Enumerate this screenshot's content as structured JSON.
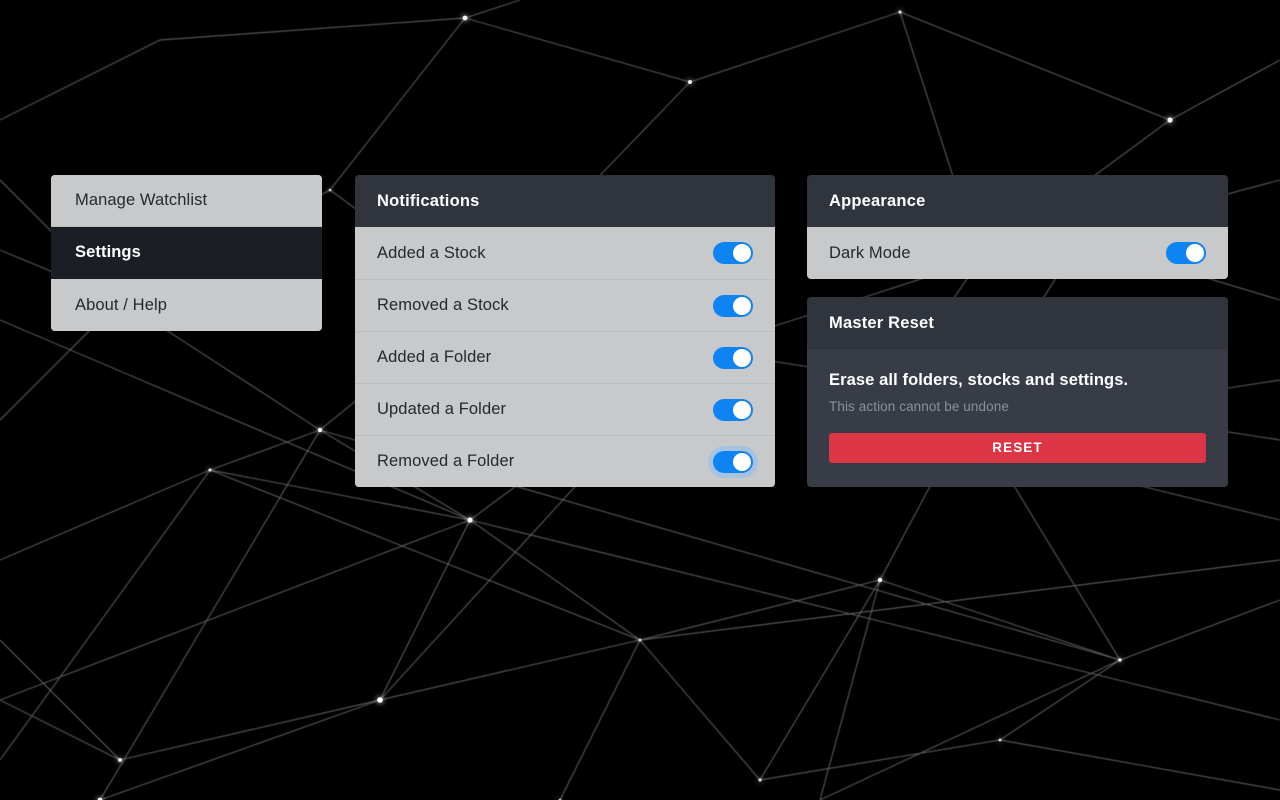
{
  "background": {
    "style": "constellation-network",
    "base_color": "#000000",
    "line_color": "#ffffff"
  },
  "sidebar": {
    "items": [
      {
        "label": "Manage Watchlist",
        "active": false
      },
      {
        "label": "Settings",
        "active": true
      },
      {
        "label": "About / Help",
        "active": false
      }
    ]
  },
  "notifications": {
    "title": "Notifications",
    "rows": [
      {
        "label": "Added a Stock",
        "toggle": true,
        "focused": false
      },
      {
        "label": "Removed a Stock",
        "toggle": true,
        "focused": false
      },
      {
        "label": "Added a Folder",
        "toggle": true,
        "focused": false
      },
      {
        "label": "Updated a Folder",
        "toggle": true,
        "focused": false
      },
      {
        "label": "Removed a Folder",
        "toggle": true,
        "focused": true
      }
    ]
  },
  "appearance": {
    "title": "Appearance",
    "rows": [
      {
        "label": "Dark Mode",
        "toggle": true,
        "focused": false
      }
    ]
  },
  "master_reset": {
    "title": "Master Reset",
    "headline": "Erase all folders, stocks and settings.",
    "subtext": "This action cannot be undone",
    "button_label": "RESET",
    "button_color": "#dc3545"
  },
  "colors": {
    "panel_header": "#2f343d",
    "panel_body": "#c8c9cb",
    "panel_dark_body": "#383c46",
    "active_item": "#1b1e24",
    "toggle_on": "#0d84f2",
    "danger": "#dc3545"
  }
}
